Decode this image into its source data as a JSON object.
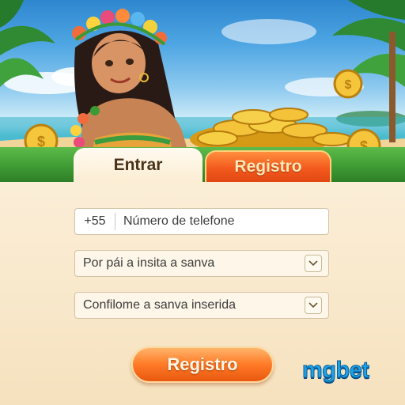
{
  "tabs": {
    "login_label": "Entrar",
    "register_label": "Registro"
  },
  "form": {
    "phone_prefix": "+55",
    "phone_placeholder": "Número de telefone",
    "password_placeholder": "Por pái a insita a sanva",
    "confirm_placeholder": "Confilome a sanva inserida",
    "submit_label": "Registro"
  },
  "brand": {
    "name": "mgbet"
  },
  "colors": {
    "accent_orange": "#f35a1d",
    "tab_green": "#3f9c34",
    "panel_cream": "#f8e7c9",
    "brand_blue": "#1aa3e8"
  },
  "icons": {
    "field_chevron": "chevron-down-icon",
    "coin": "gold-coin-icon"
  }
}
